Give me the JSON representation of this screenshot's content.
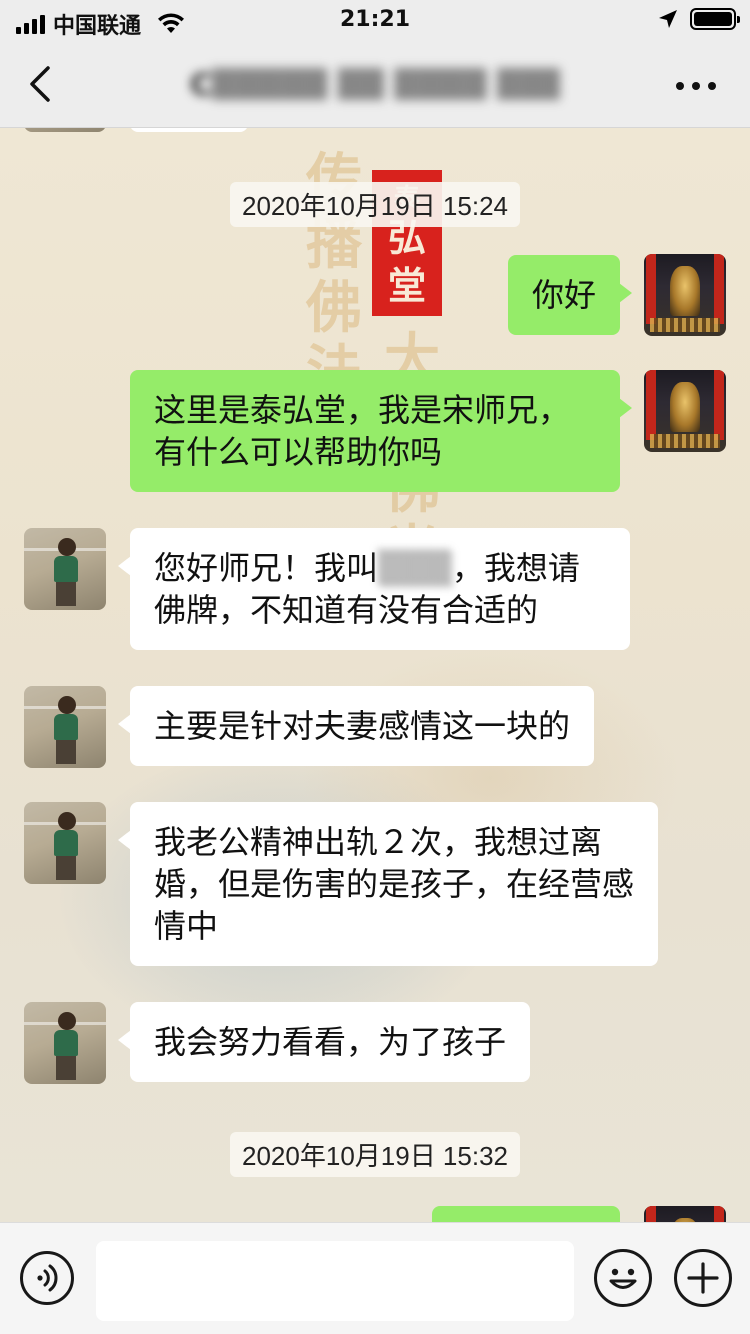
{
  "status_bar": {
    "carrier": "中国联通",
    "time": "21:21"
  },
  "nav": {
    "title": "C▒▒▒▒▒ ▒▒ ▒▒▒▒ ▒▒▒▒▒▒▒▒"
  },
  "background": {
    "seal_text": "泰弘堂",
    "seal_lines": [
      "泰",
      "弘",
      "堂"
    ]
  },
  "messages": [
    {
      "type": "timestamp",
      "text": "2020年10月19日 15:24"
    },
    {
      "type": "me",
      "text": "你好"
    },
    {
      "type": "me",
      "text": "这里是泰弘堂，我是宋师兄，有什么可以帮助你吗"
    },
    {
      "type": "other",
      "text_before": "您好师兄！我叫",
      "hidden_name": "▒▒▒",
      "text_after": "，我想请佛牌，不知道有没有合适的"
    },
    {
      "type": "other",
      "text": "主要是针对夫妻感情这一块的"
    },
    {
      "type": "other",
      "text": "我老公精神出轨２次，我想过离婚，但是伤害的是孩子，在经营感情中"
    },
    {
      "type": "other",
      "text": "我会努力看看，为了孩子"
    },
    {
      "type": "timestamp",
      "text": "2020年10月19日 15:32"
    }
  ],
  "input": {
    "value": "",
    "placeholder": ""
  },
  "colors": {
    "my_bubble": "#95ec69",
    "other_bubble": "#ffffff",
    "nav_bg": "#ededed",
    "seal_red": "#d8221d"
  },
  "icons": [
    "signal-icon",
    "wifi-icon",
    "location-icon",
    "battery-icon",
    "back-arrow-icon",
    "more-dots-icon",
    "voice-icon",
    "emoji-icon",
    "plus-icon"
  ]
}
